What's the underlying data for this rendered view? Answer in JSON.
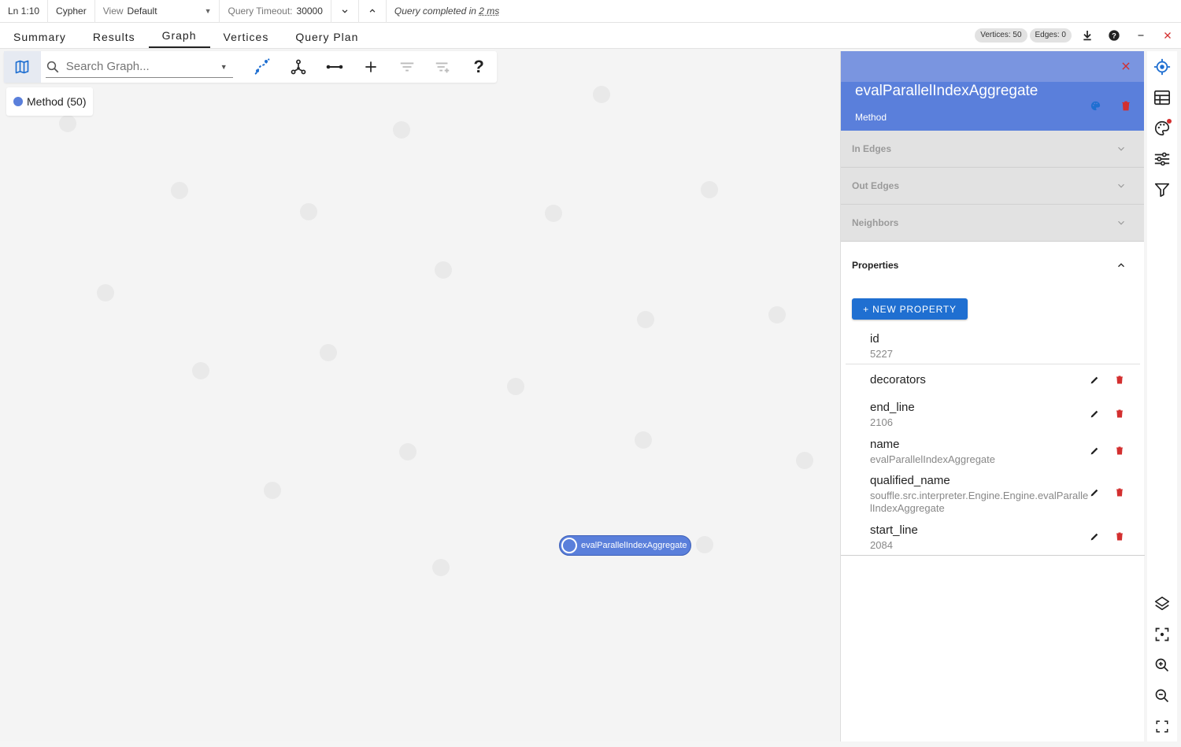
{
  "statusbar": {
    "position": "Ln 1:10",
    "language": "Cypher",
    "view_label": "View",
    "view_value": "Default",
    "timeout_label": "Query Timeout:",
    "timeout_value": "30000",
    "completed_prefix": "Query completed in",
    "completed_time": "2 ms"
  },
  "tabs": [
    "Summary",
    "Results",
    "Graph",
    "Vertices",
    "Query Plan"
  ],
  "active_tab": "Graph",
  "counts": {
    "vertices": "Vertices: 50",
    "edges": "Edges: 0"
  },
  "search": {
    "placeholder": "Search Graph..."
  },
  "toolbar": {
    "help": "?"
  },
  "legend": {
    "label": "Method (50)",
    "color": "#5a7fdb"
  },
  "node": {
    "label": "evalParallelIndexAggregate",
    "color": "#5a7fdb"
  },
  "panel": {
    "title": "evalParallelIndexAggregate",
    "subtitle": "Method",
    "sections": [
      "In Edges",
      "Out Edges",
      "Neighbors"
    ],
    "properties_label": "Properties",
    "new_property_label": "+ NEW PROPERTY",
    "properties": [
      {
        "key": "id",
        "value": "5227"
      },
      {
        "key": "decorators",
        "value": ""
      },
      {
        "key": "end_line",
        "value": "2106"
      },
      {
        "key": "name",
        "value": "evalParallelIndexAggregate"
      },
      {
        "key": "qualified_name",
        "value": "souffle.src.interpreter.Engine.Engine.evalParallelIndexAggregate"
      },
      {
        "key": "start_line",
        "value": "2084"
      }
    ]
  },
  "colors": {
    "accent": "#1f6fd1",
    "header": "#5a7fdb",
    "danger": "#d32f2f"
  }
}
